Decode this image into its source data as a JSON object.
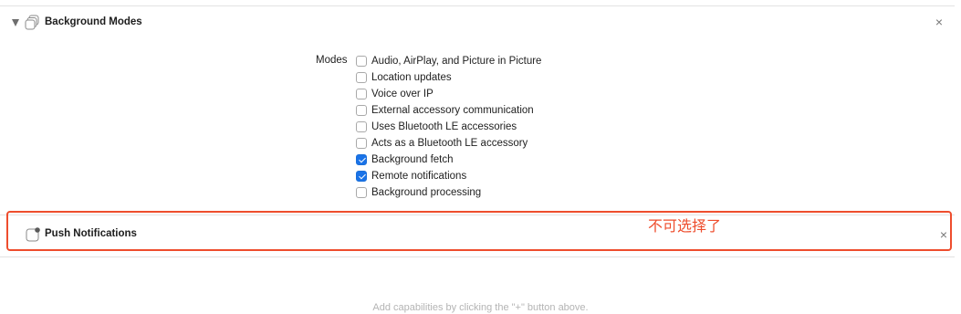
{
  "background_modes": {
    "title": "Background Modes",
    "close_glyph": "×",
    "modes_label": "Modes",
    "modes": [
      {
        "label": "Audio, AirPlay, and Picture in Picture",
        "checked": false
      },
      {
        "label": "Location updates",
        "checked": false
      },
      {
        "label": "Voice over IP",
        "checked": false
      },
      {
        "label": "External accessory communication",
        "checked": false
      },
      {
        "label": "Uses Bluetooth LE accessories",
        "checked": false
      },
      {
        "label": "Acts as a Bluetooth LE accessory",
        "checked": false
      },
      {
        "label": "Background fetch",
        "checked": true
      },
      {
        "label": "Remote notifications",
        "checked": true
      },
      {
        "label": "Background processing",
        "checked": false
      }
    ]
  },
  "push_notifications": {
    "title": "Push Notifications",
    "close_glyph": "×"
  },
  "annotation": {
    "text": "不可选择了",
    "color": "#ee4d2d"
  },
  "footer": {
    "hint": "Add capabilities by clicking the \"+\" button above."
  },
  "colors": {
    "checkbox_checked": "#1a73e8",
    "highlight_border": "#ee4d2d"
  }
}
